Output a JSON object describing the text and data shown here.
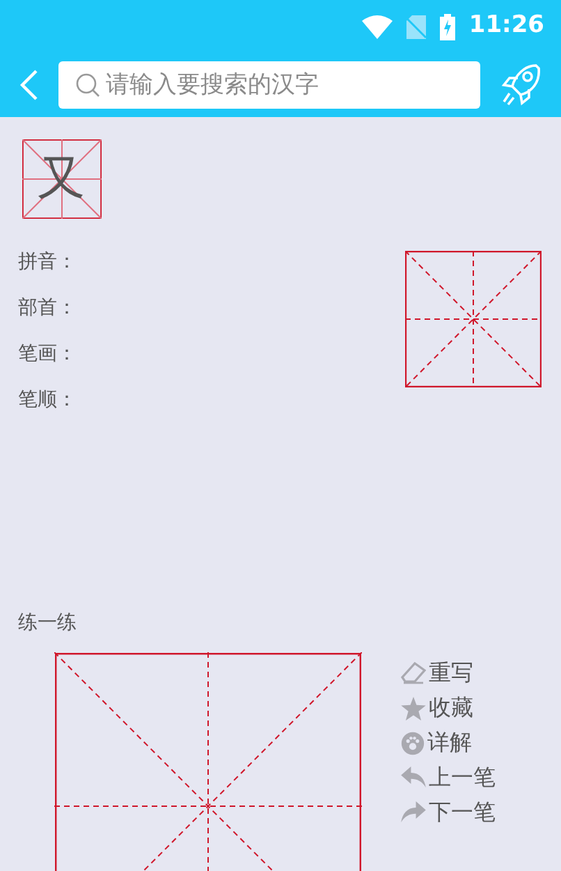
{
  "status_bar": {
    "time": "11:26"
  },
  "search": {
    "placeholder": "请输入要搜索的汉字"
  },
  "preview": {
    "character": "又"
  },
  "fields": [
    {
      "label": "拼音："
    },
    {
      "label": "部首："
    },
    {
      "label": "笔画："
    },
    {
      "label": "笔顺："
    }
  ],
  "practice": {
    "title": "练一练"
  },
  "actions": [
    {
      "kind": "erase",
      "label": "重写"
    },
    {
      "kind": "star",
      "label": "收藏"
    },
    {
      "kind": "detail",
      "label": "详解"
    },
    {
      "kind": "prev",
      "label": "上一笔"
    },
    {
      "kind": "next",
      "label": "下一笔"
    }
  ]
}
